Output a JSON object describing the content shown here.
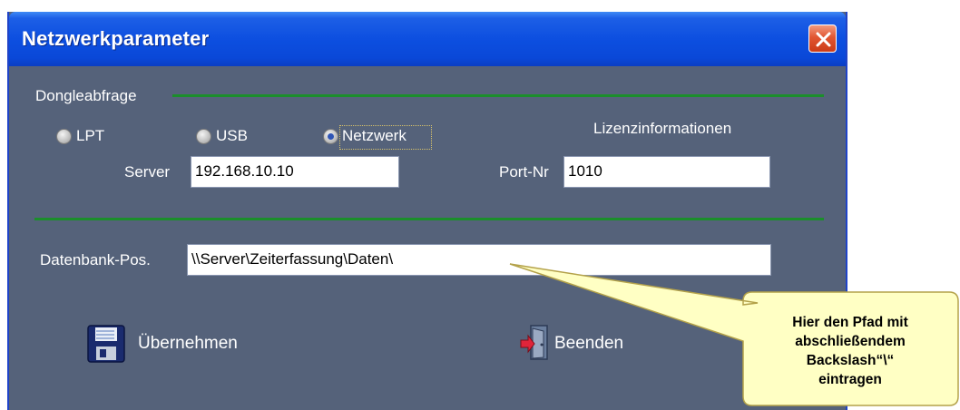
{
  "window": {
    "title": "Netzwerkparameter"
  },
  "dongle": {
    "group_label": "Dongleabfrage",
    "radios": [
      {
        "label": "LPT",
        "checked": false
      },
      {
        "label": "USB",
        "checked": false
      },
      {
        "label": "Netzwerk",
        "checked": true
      }
    ],
    "license_label": "Lizenzinformationen",
    "server_label": "Server",
    "server_value": "192.168.10.10",
    "port_label": "Port-Nr",
    "port_value": "1010"
  },
  "database": {
    "label": "Datenbank-Pos.",
    "value": "\\\\Server\\Zeiterfassung\\Daten\\"
  },
  "buttons": {
    "apply_label": "Übernehmen",
    "exit_label": "Beenden"
  },
  "tooltip": {
    "line1": "Hier den Pfad mit",
    "line2": "abschließendem",
    "line3": "Backslash“\\“",
    "line4": "eintragen"
  },
  "colors": {
    "title_bar": "#0a48d8",
    "window_bg": "#55627a",
    "separator": "#1b8e2b",
    "tooltip_bg": "#ffffc4",
    "close_button": "#e15632"
  }
}
